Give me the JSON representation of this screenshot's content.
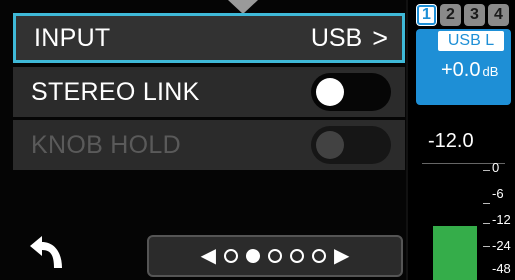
{
  "menu": {
    "rows": [
      {
        "label": "INPUT",
        "value": "USB",
        "chevron": ">"
      },
      {
        "label": "STEREO LINK",
        "toggle": "on"
      },
      {
        "label": "KNOB HOLD",
        "toggle": "off",
        "disabled": true
      }
    ],
    "pager": {
      "prev": "◀",
      "next": "▶",
      "total_pages": 5,
      "current_page": 2
    }
  },
  "panel": {
    "tracks": [
      "1",
      "2",
      "3",
      "4"
    ],
    "active_track": "1",
    "source": "USB L",
    "gain": "+0.0",
    "gain_unit": "dB",
    "peak": "-12.0",
    "scale": [
      "0",
      "-6",
      "-12",
      "-24",
      "-48"
    ],
    "level_color": "#35ad4a",
    "accent": "#1e8fd6",
    "highlight": "#3fb9d8"
  }
}
